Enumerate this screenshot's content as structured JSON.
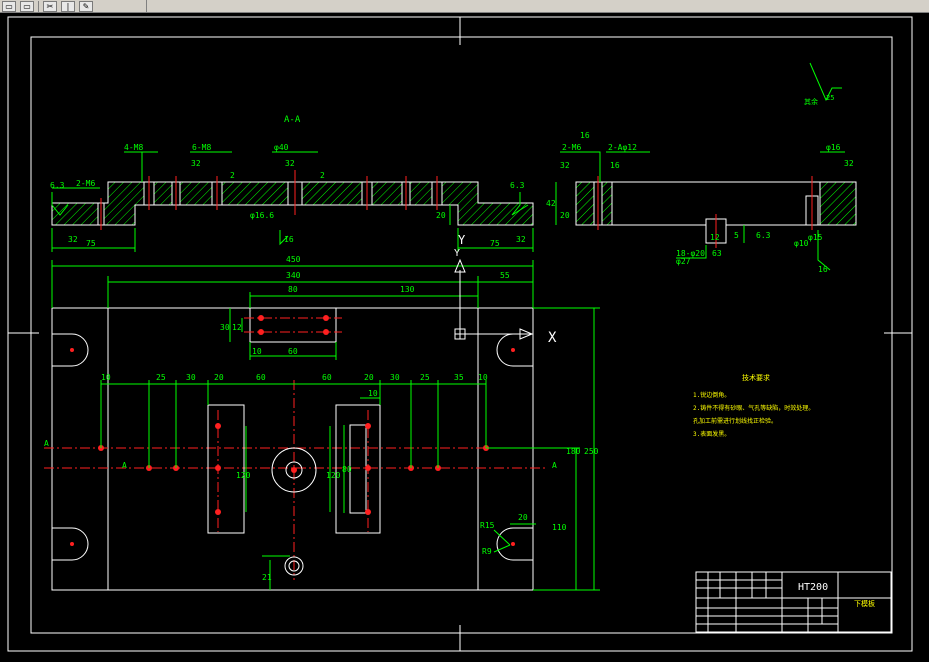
{
  "toolbar": {
    "buttons": [
      {
        "name": "new-file-button",
        "glyph": "▭"
      },
      {
        "name": "open-file-button",
        "glyph": "▭"
      },
      {
        "name": "cut-button",
        "glyph": "✂"
      },
      {
        "name": "copy-button",
        "glyph": "|"
      },
      {
        "name": "paint-button",
        "glyph": "✎"
      }
    ]
  },
  "colors": {
    "background": "#000000",
    "geometry": "#ffffff",
    "dimension": "#00ff00",
    "centerline": "#ff2020",
    "hatch": "#00ff00",
    "text_yellow": "#ffff00"
  },
  "section": {
    "title": "A-A",
    "left_callouts": [
      "6.3",
      "2-M6"
    ],
    "mid_callouts": [
      "4-M8",
      "6-M8",
      "32",
      "2",
      "φ40",
      "32",
      "2"
    ],
    "bottom_callouts": [
      "φ16.6",
      "16"
    ],
    "left_dims": [
      "32",
      "75"
    ],
    "right_callouts": [
      "6.3",
      "20",
      "Y",
      "75",
      "32"
    ]
  },
  "side_view": {
    "left_callouts": [
      "2-M6",
      "32",
      "16",
      "2-Aφ12",
      "16",
      "42",
      "20"
    ],
    "right_callouts": [
      "φ16",
      "32",
      "φ10",
      "φ15",
      "16"
    ],
    "bottom_callouts": [
      "18-φ20",
      "φ27",
      "5",
      "6.3",
      "12",
      "63"
    ],
    "roughness_symbol": "其余",
    "roughness_value": "25"
  },
  "plan": {
    "overall": [
      "450",
      "340",
      "55"
    ],
    "top_group": [
      "80",
      "130",
      "30",
      "12",
      "10",
      "60"
    ],
    "row_dims": [
      "10",
      "25",
      "30",
      "20",
      "60",
      "60",
      "20",
      "30",
      "25",
      "35",
      "10"
    ],
    "slot_dims": [
      "10",
      "120",
      "120",
      "80"
    ],
    "right_dims": [
      "180",
      "250",
      "110",
      "R15",
      "R9",
      "20"
    ],
    "bottom_dims": [
      "21"
    ],
    "section_marks": [
      "A",
      "A",
      "A"
    ],
    "ucs": {
      "x": "X",
      "y": "Y"
    }
  },
  "notes": {
    "title": "技术要求",
    "items": [
      "1.锐边倒角。",
      "2.铸件不得有砂眼、气孔等缺陷，时效处理。",
      "孔加工前需进行划线找正检验。",
      "3.表面发黑。"
    ]
  },
  "title_block": {
    "material": "HT200",
    "part_name": "下模板"
  }
}
